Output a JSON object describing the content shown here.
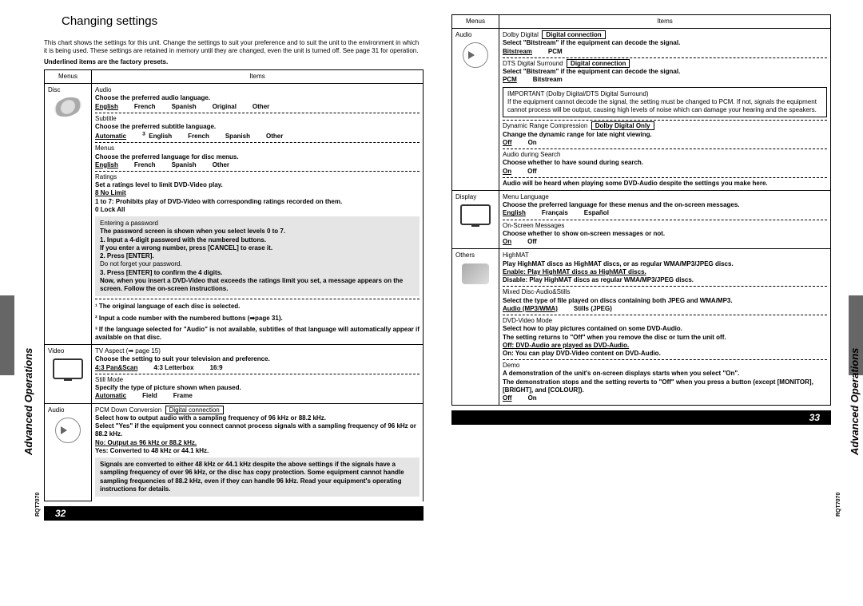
{
  "heading": "Changing settings",
  "intro1": "This chart shows the settings for this unit. Change the settings to suit your preference and to suit the unit to the environment in which it is being used. These settings are retained in memory until they are changed, even the unit is turned off. See page 31 for operation.",
  "intro2": "Underlined items are the factory presets.",
  "header_menus": "Menus",
  "header_items": "Items",
  "side_label": "Advanced Operations",
  "doc_code": "RQT7070",
  "page_left": "32",
  "page_right": "33",
  "left": {
    "disc": {
      "label": "Disc",
      "audio": {
        "title": "Audio",
        "desc": "Choose the preferred audio language.",
        "opts": [
          "English",
          "French",
          "Spanish",
          "Original",
          "Other"
        ],
        "sup": "2"
      },
      "subtitle": {
        "title": "Subtitle",
        "desc": "Choose the preferred subtitle language.",
        "opts": [
          "Automatic",
          "English",
          "French",
          "Spanish",
          "Other"
        ],
        "sup3": "3",
        "sup": "2"
      },
      "menus": {
        "title": "Menus",
        "desc": "Choose the preferred language for disc menus.",
        "opts": [
          "English",
          "French",
          "Spanish",
          "Other"
        ],
        "sup": "2"
      },
      "ratings": {
        "title": "Ratings",
        "desc": "Set a ratings level to limit DVD-Video play.",
        "p8": "8 No Limit",
        "p17": "1 to 7:  Prohibits play of DVD-Video with corresponding ratings recorded on them.",
        "p0": "0 Lock All",
        "pw_title": "Entering a password",
        "pw1": "The password screen is shown when you select levels 0 to 7.",
        "pw2": "1.  Input a 4-digit password with the numbered buttons.",
        "pw3": "     If you enter a wrong number, press [CANCEL] to erase it.",
        "pw4": "2.  Press [ENTER].",
        "pw5": "     Do not forget your password.",
        "pw6": "3.  Press [ENTER] to confirm the 4 digits.",
        "pw7": "     Now, when you insert a DVD-Video that exceeds the ratings limit you set, a message appears on the screen. Follow the on-screen instructions.",
        "fn1": "¹ The original language of each disc is selected.",
        "fn2": "² Input a code number with the numbered buttons (➡page 31).",
        "fn3": "³ If the language selected for \"Audio\" is not available, subtitles of that language will automatically appear if available on that disc."
      }
    },
    "video": {
      "label": "Video",
      "tvaspect": {
        "title": "TV Aspect  (➡ page 15)",
        "desc": "Choose the setting to suit your television and preference.",
        "opts": [
          "4:3 Pan&Scan",
          "4:3 Letterbox",
          "16:9"
        ]
      },
      "still": {
        "title": "Still Mode",
        "desc": "Specify the type of picture shown when paused.",
        "opts": [
          "Automatic",
          "Field",
          "Frame"
        ]
      }
    },
    "audio": {
      "label": "Audio",
      "pcm": {
        "title": "PCM Down Conversion",
        "conn": "Digital connection",
        "d1": "Select how to output audio with a sampling frequency of 96 kHz or 88.2 kHz.",
        "d2": "Select \"Yes\" if the equipment you connect cannot process signals with a sampling frequency of 96 kHz or 88.2 kHz.",
        "no": "No:   Output as 96 kHz or 88.2 kHz.",
        "yes": "Yes:  Converted to 48 kHz or 44.1 kHz.",
        "note": "Signals are converted to either 48 kHz or 44.1 kHz despite the above settings if the signals have a sampling frequency of over 96 kHz, or the disc has copy protection. Some equipment cannot handle sampling frequencies of 88.2 kHz, even if they can handle 96 kHz. Read your equipment's operating instructions for details."
      }
    }
  },
  "right": {
    "audio": {
      "label": "Audio",
      "dolby": {
        "title": "Dolby Digital",
        "conn": "Digital connection",
        "desc": "Select \"Bitstream\" if the equipment can decode the signal.",
        "opts": [
          "Bitstream",
          "PCM"
        ]
      },
      "dts": {
        "title": "DTS Digital Surround",
        "conn": "Digital connection",
        "desc": "Select \"Bitstream\" if the equipment can decode the signal.",
        "opts": [
          "PCM",
          "Bitstream"
        ]
      },
      "important": {
        "t": "IMPORTANT (Dolby Digital/DTS Digital Surround)",
        "b": "If the equipment cannot decode the signal, the setting must be changed to PCM. If not, signals the equipment cannot process will be output, causing high levels of noise which can damage your hearing and the speakers."
      },
      "drc": {
        "title": "Dynamic Range Compression",
        "conn": "Dolby Digital Only",
        "desc": "Change the dynamic range for late night viewing.",
        "opts": [
          "Off",
          "On"
        ]
      },
      "search": {
        "title": "Audio during Search",
        "desc": "Choose whether to have sound during search.",
        "opts": [
          "On",
          "Off"
        ],
        "note": "Audio will be heard when playing some DVD-Audio despite the settings you make here."
      }
    },
    "display": {
      "label": "Display",
      "menulang": {
        "title": "Menu Language",
        "desc": "Choose the preferred language for these menus and the on-screen messages.",
        "opts": [
          "English",
          "Français",
          "Español"
        ]
      },
      "osm": {
        "title": "On-Screen Messages",
        "desc": "Choose whether to show on-screen messages or not.",
        "opts": [
          "On",
          "Off"
        ]
      }
    },
    "others": {
      "label": "Others",
      "highmat": {
        "title": "HighMAT",
        "desc": "Play HighMAT discs as HighMAT discs, or as regular WMA/MP3/JPEG discs.",
        "e": "Enable:   Play HighMAT discs as HighMAT discs.",
        "d": "Disable:  Play HighMAT discs as regular WMA/MP3/JPEG discs."
      },
      "mixed": {
        "title": "Mixed Disc-Audio&Stills",
        "desc": "Select the type of file played on discs containing both JPEG and WMA/MP3.",
        "opts": [
          "Audio (MP3/WMA)",
          "Stills (JPEG)"
        ]
      },
      "dvdvideo": {
        "title": "DVD-Video Mode",
        "d1": "Select how to play pictures contained on some DVD-Audio.",
        "d2": "The setting returns to \"Off\" when you remove the disc or turn the unit off.",
        "off": "Off:  DVD-Audio are played as DVD-Audio.",
        "on": "On:  You can play DVD-Video content on DVD-Audio."
      },
      "demo": {
        "title": "Demo",
        "d1": "A demonstration of the unit's on-screen displays starts when you select \"On\".",
        "d2": "The demonstration stops and the setting reverts to \"Off\" when you press a button (except [MONITOR], [BRIGHT], and [COLOUR]).",
        "opts": [
          "Off",
          "On"
        ]
      }
    }
  }
}
